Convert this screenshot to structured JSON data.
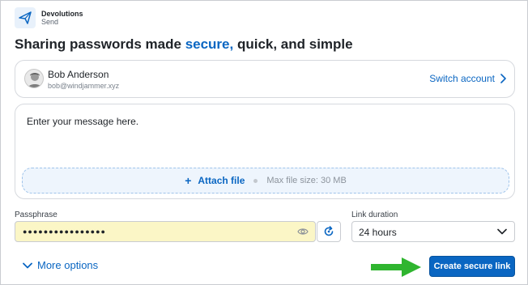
{
  "app": {
    "name": "Devolutions",
    "product": "Send"
  },
  "title": {
    "prefix": "Sharing passwords made ",
    "accent": "secure,",
    "suffix": " quick, and simple"
  },
  "account": {
    "name": "Bob Anderson",
    "email": "bob@windjammer.xyz",
    "switch_label": "Switch account"
  },
  "message": {
    "placeholder": "Enter your message here.",
    "value": ""
  },
  "attach": {
    "label": "Attach file",
    "max_size": "Max file size: 30 MB"
  },
  "passphrase": {
    "label": "Passphrase",
    "masked": "●●●●●●●●●●●●●●●●"
  },
  "duration": {
    "label": "Link duration",
    "selected": "24 hours"
  },
  "footer": {
    "more_options": "More options",
    "create_label": "Create secure link"
  },
  "colors": {
    "accent": "#0a66c2",
    "passphrase_bg": "#fbf6c6",
    "attach_bg": "#eef5fd",
    "arrow": "#2fb52f"
  },
  "icons": {
    "logo": "send-logo-icon",
    "switch": "chevron-right-icon",
    "eye": "eye-icon",
    "regenerate": "refresh-icon",
    "duration": "chevron-down-icon",
    "more": "chevron-down-icon",
    "annotation": "green-arrow-icon"
  }
}
